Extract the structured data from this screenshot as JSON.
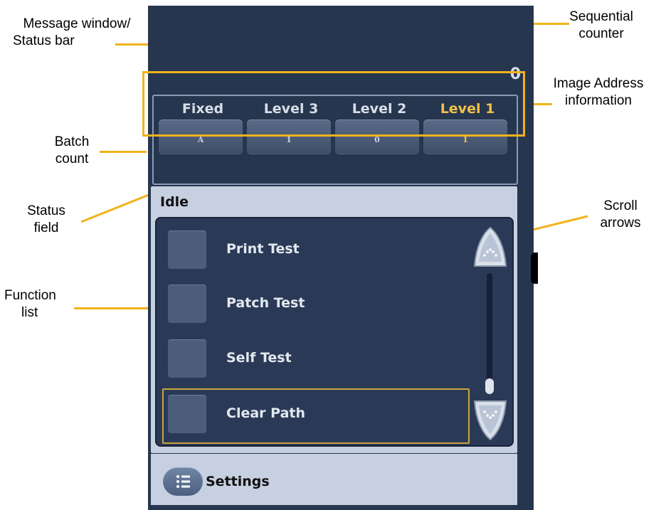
{
  "callouts": {
    "message_window": [
      "Message window/",
      "Status bar"
    ],
    "sequential_counter": [
      "Sequential",
      "counter"
    ],
    "image_address": [
      "Image Address",
      "information"
    ],
    "batch_count": [
      "Batch",
      "count"
    ],
    "status_field": [
      "Status",
      "field"
    ],
    "scroll_arrows": [
      "Scroll",
      "arrows"
    ],
    "function_list": [
      "Function",
      "list"
    ]
  },
  "sequential_counter": "0",
  "image_address": {
    "headers": [
      "Fixed",
      "Level 3",
      "Level 2",
      "Level 1"
    ],
    "values": [
      "A",
      "1",
      "0",
      "1"
    ],
    "active_index": 3
  },
  "status": "Idle",
  "functions": [
    {
      "label": "Print Test",
      "selected": false
    },
    {
      "label": "Patch Test",
      "selected": false
    },
    {
      "label": "Self Test",
      "selected": false
    },
    {
      "label": "Clear Path",
      "selected": true
    }
  ],
  "settings_label": "Settings",
  "icons": {
    "scroll_up": "scroll-up-arrow-icon",
    "scroll_down": "scroll-down-arrow-icon",
    "settings": "settings-list-icon"
  },
  "colors": {
    "panel": "#27364f",
    "callout_line": "#f2b21c",
    "active_level": "#f0c24a"
  }
}
